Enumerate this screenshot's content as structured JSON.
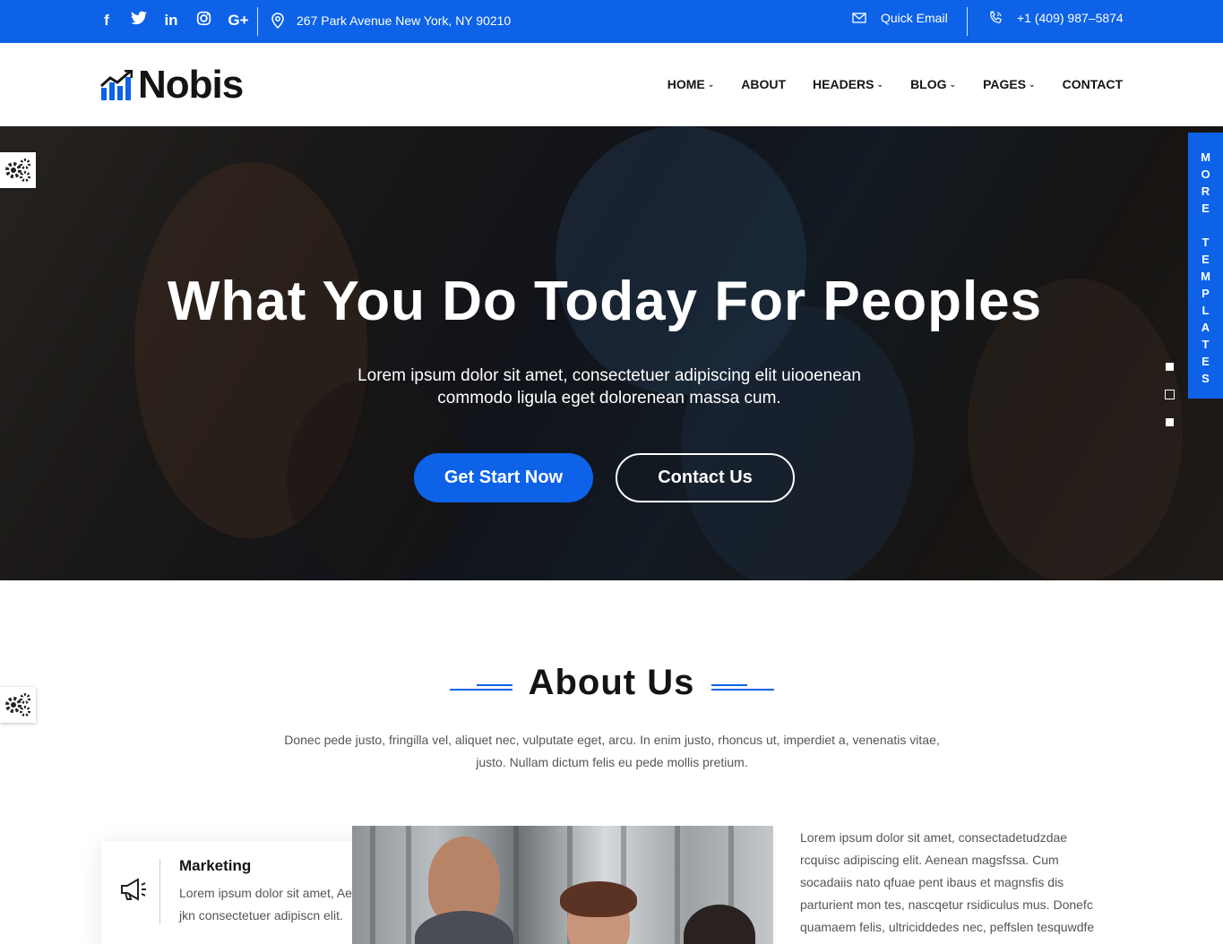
{
  "topbar": {
    "social": [
      "facebook-icon",
      "twitter-icon",
      "linkedin-icon",
      "instagram-icon",
      "google-plus-icon"
    ],
    "address": "267 Park Avenue New York, NY 90210",
    "email_label": "Quick Email",
    "phone": "+1 (409) 987–5874"
  },
  "brand": {
    "name": "Nobis"
  },
  "nav": {
    "items": [
      {
        "label": "HOME",
        "dropdown": true
      },
      {
        "label": "ABOUT",
        "dropdown": false
      },
      {
        "label": "HEADERS",
        "dropdown": true
      },
      {
        "label": "BLOG",
        "dropdown": true
      },
      {
        "label": "PAGES",
        "dropdown": true
      },
      {
        "label": "CONTACT",
        "dropdown": false
      }
    ]
  },
  "hero": {
    "title": "What You Do Today For Peoples",
    "subtitle_line1": "Lorem ipsum dolor sit amet, consectetuer adipiscing elit uiooenean",
    "subtitle_line2": "commodo ligula eget dolorenean massa cum.",
    "primary_button": "Get Start Now",
    "secondary_button": "Contact Us",
    "slides_active": 2
  },
  "side_tab": {
    "label": "MORE TEMPLATES"
  },
  "about": {
    "title": "About Us",
    "description_line1": "Donec pede justo, fringilla vel, aliquet nec, vulputate eget, arcu. In enim justo, rhoncus ut, imperdiet a, venenatis vitae,",
    "description_line2": "justo. Nullam dictum felis eu pede mollis pretium.",
    "card": {
      "title": "Marketing",
      "text_line1": "Lorem ipsum dolor sit amet, Aenea",
      "text_line2": "jkn consectetuer adipiscn elit."
    },
    "right_text": [
      "Lorem ipsum dolor sit amet, consectadetudzdae",
      "rcquisc adipiscing elit. Aenean magsfssa. Cum",
      "socadaiis nato qfuae pent ibaus et magnsfis dis",
      "parturient mon tes, nascqetur rsidiculus mus. Donefc",
      "quamaem felis, ultriciddedes nec, peffslen tesquwdfe"
    ]
  },
  "colors": {
    "accent": "#0d62e8",
    "dark": "#141414",
    "text": "#555555"
  }
}
